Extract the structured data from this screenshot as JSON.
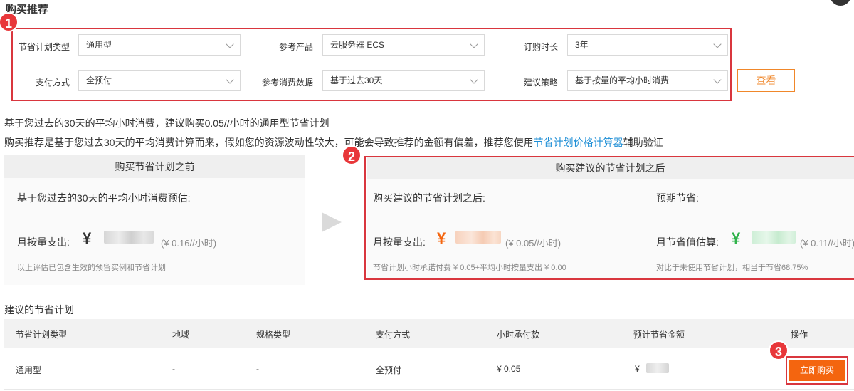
{
  "page": {
    "title": "购买推荐"
  },
  "callouts": [
    "1",
    "2",
    "3"
  ],
  "form": {
    "plan_type": {
      "label": "节省计划类型",
      "value": "通用型"
    },
    "product": {
      "label": "参考产品",
      "value": "云服务器 ECS"
    },
    "duration": {
      "label": "订购时长",
      "value": "3年"
    },
    "payment": {
      "label": "支付方式",
      "value": "全预付"
    },
    "consumption_data": {
      "label": "参考消费数据",
      "value": "基于过去30天"
    },
    "strategy": {
      "label": "建议策略",
      "value": "基于按量的平均小时消费"
    },
    "view_button": "查看"
  },
  "description": {
    "line1": "基于您过去的30天的平均小时消费，建议购买0.05//小时的通用型节省计划",
    "line2_prefix": "购买推荐是基于您过去30天的平均消费计算而来，假如您的资源波动性较大，可能会导致推荐的金额有偏差，推荐您使用",
    "line2_link": "节省计划价格计算器",
    "line2_suffix": "辅助验证"
  },
  "before_panel": {
    "header": "购买节省计划之前",
    "subtitle": "基于您过去的30天的平均小时消费预估:",
    "monthly_label": "月按量支出:",
    "currency": "¥",
    "rate": "(¥ 0.16//小时)",
    "note": "以上评估已包含生效的预留实例和节省计划"
  },
  "after_panel": {
    "header": "购买建议的节省计划之后",
    "subtitle": "购买建议的节省计划之后:",
    "monthly_label": "月按量支出:",
    "currency": "¥",
    "rate": "(¥ 0.05//小时)",
    "note": "节省计划小时承诺付费 ¥ 0.05+平均小时按量支出 ¥ 0.00",
    "savings_subtitle": "预期节省:",
    "savings_label": "月节省值估算:",
    "savings_currency": "¥",
    "savings_rate": "(¥ 0.11//小时)",
    "savings_note": "对比于未使用节省计划，相当于节省68.75%"
  },
  "recommended": {
    "title": "建议的节省计划",
    "columns": [
      "节省计划类型",
      "地域",
      "规格类型",
      "支付方式",
      "小时承付款",
      "预计节省金额",
      "操作"
    ],
    "row": {
      "plan_type": "通用型",
      "region": "-",
      "spec": "-",
      "payment": "全预付",
      "hourly": "¥ 0.05",
      "savings_currency": "¥",
      "action": "立即购买"
    }
  },
  "colors": {
    "accent_orange": "#f4650f",
    "savings_green": "#2fb24a",
    "callout_red": "#e8373a",
    "link_blue": "#1f8fd6"
  }
}
